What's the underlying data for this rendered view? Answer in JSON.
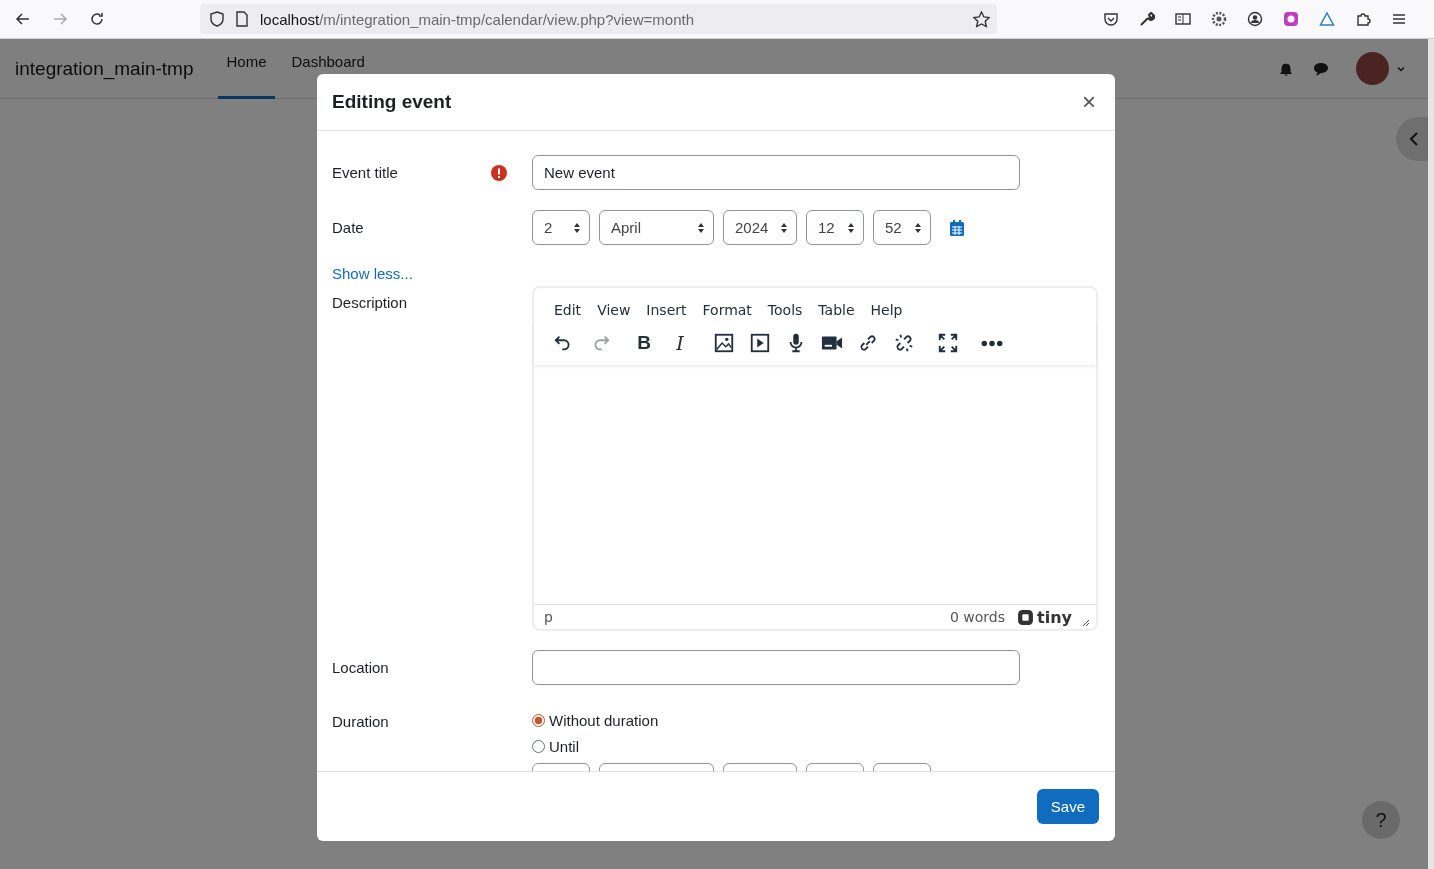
{
  "browser": {
    "url_host": "localhost",
    "url_path": "/m/integration_main-tmp/calendar/view.php?view=month"
  },
  "site": {
    "name": "integration_main-tmp",
    "nav": [
      {
        "label": "Home",
        "selected": true
      },
      {
        "label": "Dashboard",
        "selected": false
      }
    ]
  },
  "modal": {
    "title": "Editing event",
    "close": "×",
    "event_title": {
      "label": "Event title",
      "value": "New event",
      "required": true
    },
    "date": {
      "label": "Date",
      "selects": [
        "2",
        "April",
        "2024",
        "12",
        "52"
      ]
    },
    "show_less": "Show less...",
    "description": {
      "label": "Description",
      "menu": [
        "Edit",
        "View",
        "Insert",
        "Format",
        "Tools",
        "Table",
        "Help"
      ],
      "toolbar": [
        [
          {
            "kind": "undo",
            "disabled": false
          },
          {
            "kind": "redo",
            "disabled": true
          }
        ],
        [
          {
            "kind": "bold",
            "glyph": "B",
            "disabled": false
          },
          {
            "kind": "italic",
            "glyph": "I",
            "disabled": false
          }
        ],
        [
          {
            "kind": "image",
            "disabled": false
          },
          {
            "kind": "media",
            "disabled": false
          },
          {
            "kind": "mic",
            "disabled": false
          },
          {
            "kind": "video",
            "disabled": false
          },
          {
            "kind": "link",
            "disabled": false
          },
          {
            "kind": "unlink",
            "disabled": false
          }
        ],
        [
          {
            "kind": "fullscreen",
            "disabled": false
          }
        ],
        [
          {
            "kind": "more",
            "disabled": false
          }
        ]
      ],
      "path": "p",
      "word_count": "0 words",
      "brand": "tiny"
    },
    "location": {
      "label": "Location"
    },
    "duration": {
      "label": "Duration",
      "options": [
        {
          "label": "Without duration",
          "selected": true
        },
        {
          "label": "Until",
          "selected": false
        }
      ]
    },
    "save": "Save"
  },
  "help": "?"
}
